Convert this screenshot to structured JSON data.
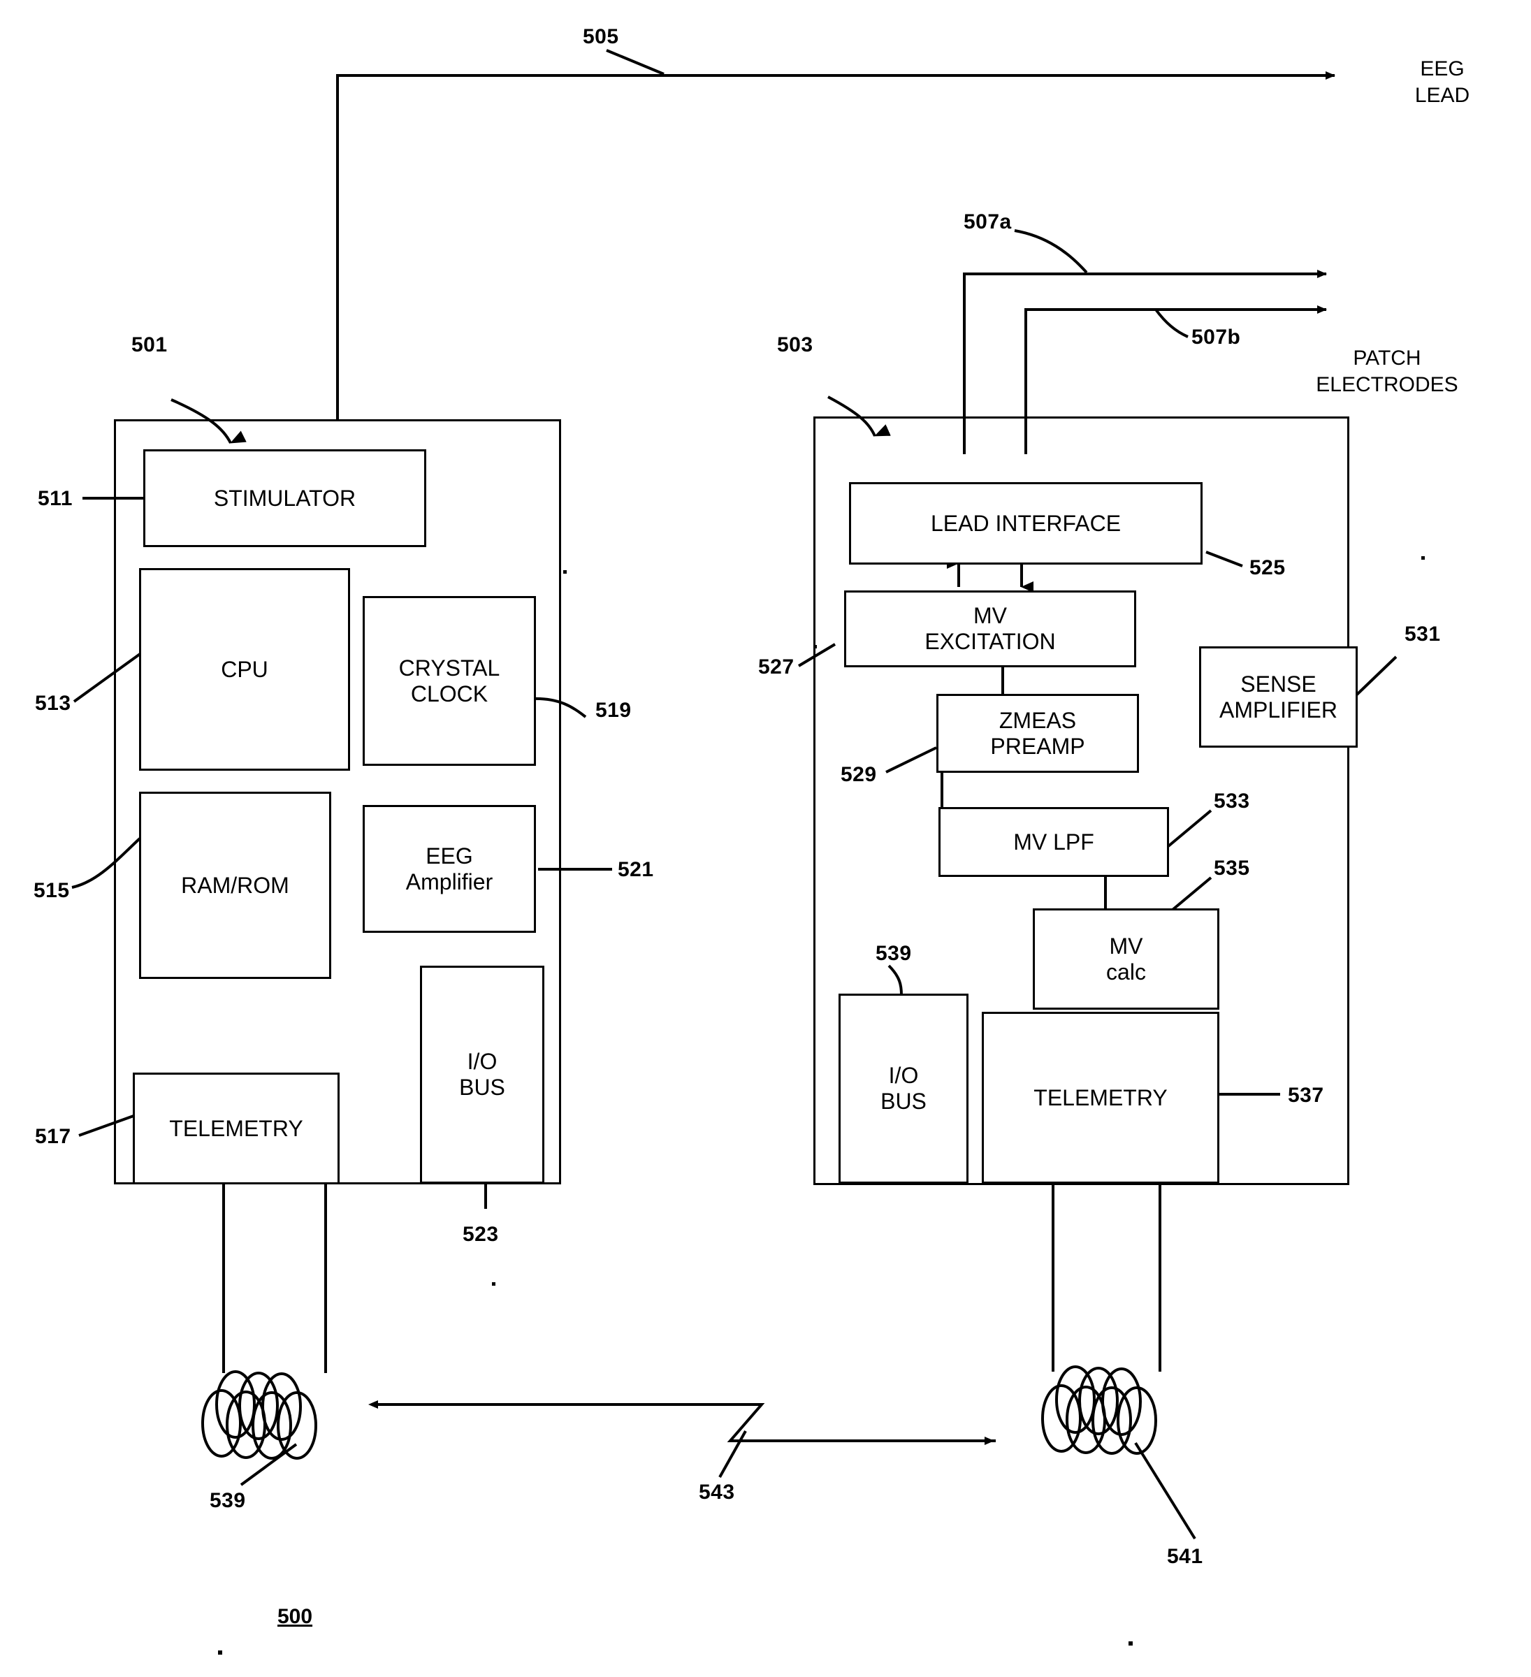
{
  "figure": {
    "number": "500",
    "title_labels": {
      "eeg_lead": "EEG\nLEAD",
      "patch_electrodes": "PATCH\nELECTRODES"
    }
  },
  "devices": [
    {
      "id": "neurostimulator",
      "ref": "501",
      "blocks": [
        {
          "ref": "511",
          "label": "STIMULATOR"
        },
        {
          "ref": "513",
          "label": "CPU"
        },
        {
          "ref": "519",
          "label": "CRYSTAL\nCLOCK"
        },
        {
          "ref": "515",
          "label": "RAM/ROM"
        },
        {
          "ref": "521",
          "label": "EEG\nAmplifier"
        },
        {
          "ref": "523",
          "label": "I/O\nBUS"
        },
        {
          "ref": "517",
          "label": "TELEMETRY"
        }
      ],
      "antenna": {
        "ref": "539"
      }
    },
    {
      "id": "cardiac-device",
      "ref": "503",
      "blocks": [
        {
          "ref": "525",
          "label": "LEAD INTERFACE"
        },
        {
          "ref": "527",
          "label": "MV\nEXCITATION"
        },
        {
          "ref": "529",
          "label": "ZMEAS\nPREAMP"
        },
        {
          "ref": "531",
          "label": "SENSE\nAMPLIFIER"
        },
        {
          "ref": "533",
          "label": "MV LPF"
        },
        {
          "ref": "535",
          "label": "MV\ncalc"
        },
        {
          "ref": "539",
          "label": "I/O\nBUS"
        },
        {
          "ref": "537",
          "label": "TELEMETRY"
        }
      ],
      "antenna": {
        "ref": "541"
      }
    }
  ],
  "leads": [
    {
      "ref": "505",
      "name": "eeg-lead"
    },
    {
      "ref": "507a",
      "name": "patch-electrode-lead-a"
    },
    {
      "ref": "507b",
      "name": "patch-electrode-lead-b"
    }
  ],
  "telemetry_link": {
    "ref": "543"
  },
  "refs": {
    "r500": "500",
    "r501": "501",
    "r503": "503",
    "r505": "505",
    "r507a": "507a",
    "r507b": "507b",
    "r511": "511",
    "r513": "513",
    "r515": "515",
    "r517": "517",
    "r519": "519",
    "r521": "521",
    "r523": "523",
    "r525": "525",
    "r527": "527",
    "r529": "529",
    "r531": "531",
    "r533": "533",
    "r535": "535",
    "r537": "537",
    "r539a": "539",
    "r539b": "539",
    "r541": "541",
    "r543": "543"
  },
  "block_labels": {
    "stimulator": "STIMULATOR",
    "cpu": "CPU",
    "crystal_clock": "CRYSTAL\nCLOCK",
    "ram_rom": "RAM/ROM",
    "eeg_amplifier": "EEG\nAmplifier",
    "io_bus_left": "I/O\nBUS",
    "telemetry_left": "TELEMETRY",
    "lead_interface": "LEAD INTERFACE",
    "mv_excitation": "MV\nEXCITATION",
    "zmeas_preamp": "ZMEAS\nPREAMP",
    "sense_amplifier": "SENSE\nAMPLIFIER",
    "mv_lpf": "MV LPF",
    "mv_calc": "MV\ncalc",
    "io_bus_right": "I/O\nBUS",
    "telemetry_right": "TELEMETRY"
  },
  "external_labels": {
    "eeg_lead": "EEG\nLEAD",
    "patch_electrodes": "PATCH\nELECTRODES"
  },
  "colors": {
    "ink": "#000000",
    "paper": "#ffffff"
  }
}
